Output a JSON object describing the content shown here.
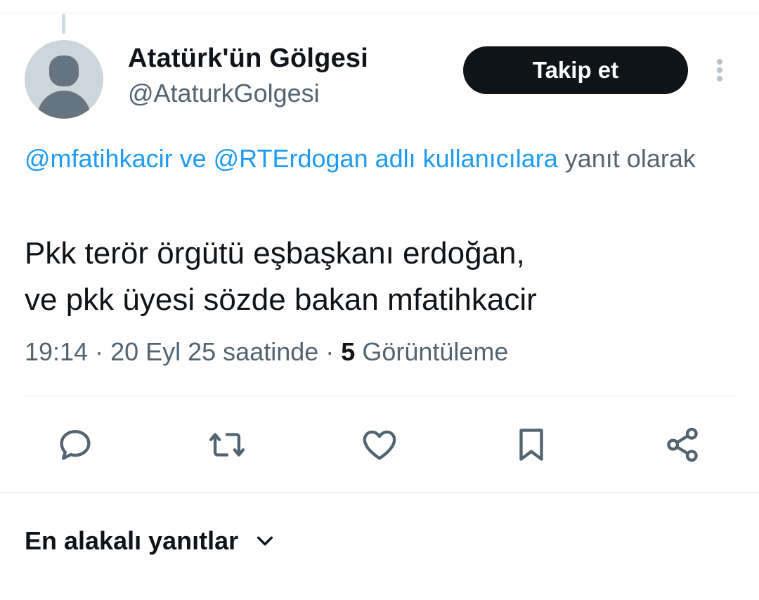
{
  "tweet": {
    "author": {
      "display_name": "Atatürk'ün Gölgesi",
      "handle": "@AtaturkGolgesi"
    },
    "follow_label": "Takip et",
    "reply_context": {
      "mentions": "@mfatihkacir ve @RTErdogan adlı kullanıcılara",
      "suffix": " yanıt olarak"
    },
    "text_lines": [
      "Pkk terör örgütü eşbaşkanı erdoğan,",
      "ve pkk üyesi sözde bakan mfatihkacir"
    ],
    "meta": {
      "timestamp": "19:14 · 20 Eyl 25 saatinde · ",
      "views_count": "5",
      "views_label": " Görüntüleme"
    },
    "actions": [
      {
        "icon": "reply-icon"
      },
      {
        "icon": "retweet-icon"
      },
      {
        "icon": "like-icon"
      },
      {
        "icon": "bookmark-icon"
      },
      {
        "icon": "share-icon"
      }
    ]
  },
  "replies": {
    "sort_label": "En alakalı yanıtlar",
    "sort_icon": "chevron-down-icon"
  },
  "colors": {
    "text_primary": "#0f1419",
    "text_secondary": "#536471",
    "accent": "#1d9bf0",
    "divider": "#e7e9ea"
  }
}
